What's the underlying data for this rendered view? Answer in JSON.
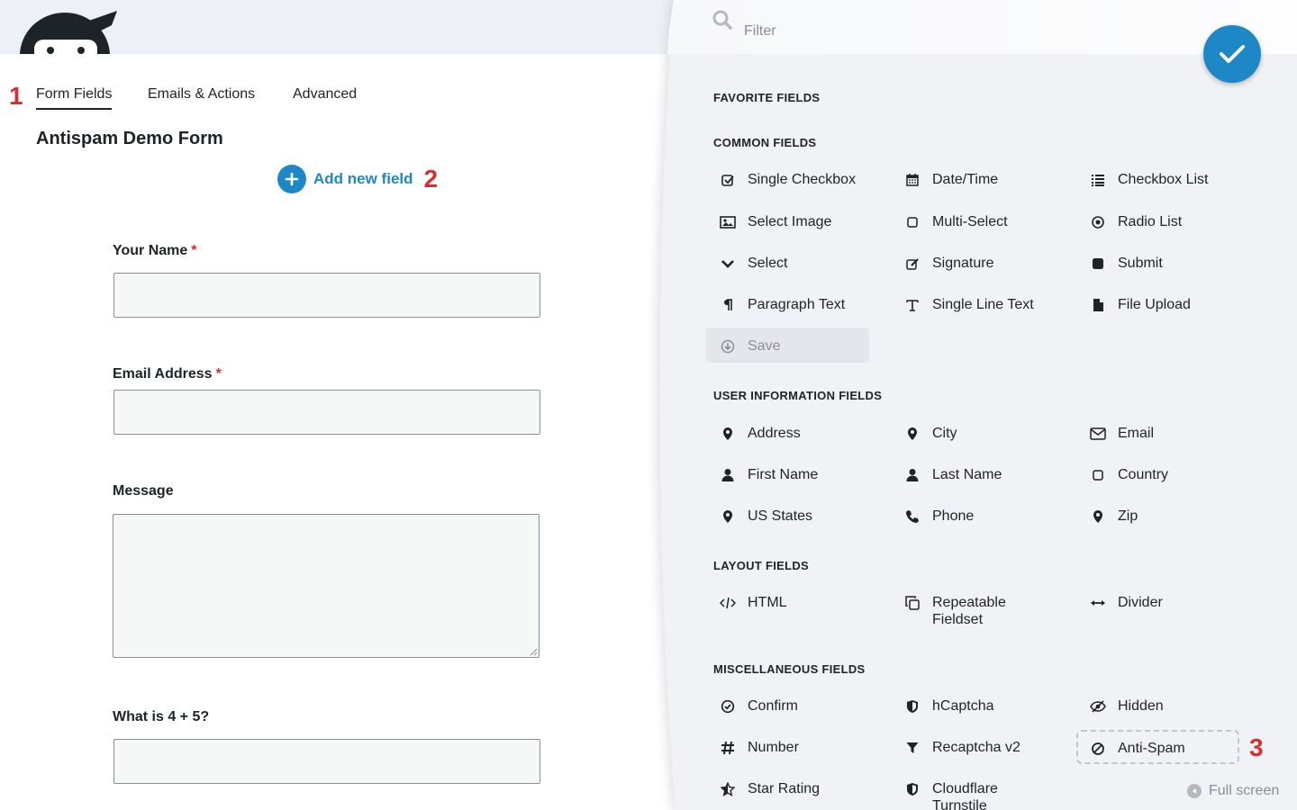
{
  "tabs": {
    "form_fields": "Form Fields",
    "emails_actions": "Emails & Actions",
    "advanced": "Advanced"
  },
  "annotations": {
    "one": "1",
    "two": "2",
    "three": "3"
  },
  "form": {
    "title": "Antispam Demo Form",
    "add_field_label": "Add new field",
    "fields": {
      "name_label": "Your Name",
      "email_label": "Email Address",
      "message_label": "Message",
      "math_label": "What is 4 + 5?",
      "required_mark": "*"
    }
  },
  "drawer": {
    "filter_placeholder": "Filter",
    "sections": {
      "favorite": "FAVORITE FIELDS",
      "common": "COMMON FIELDS",
      "user_info": "USER INFORMATION FIELDS",
      "layout": "LAYOUT FIELDS",
      "misc": "MISCELLANEOUS FIELDS"
    },
    "common": [
      "Single Checkbox",
      "Date/Time",
      "Checkbox List",
      "Select Image",
      "Multi-Select",
      "Radio List",
      "Select",
      "Signature",
      "Submit",
      "Paragraph Text",
      "Single Line Text",
      "File Upload",
      "Save"
    ],
    "user_info": [
      "Address",
      "City",
      "Email",
      "First Name",
      "Last Name",
      "Country",
      "US States",
      "Phone",
      "Zip"
    ],
    "layout": [
      "HTML",
      "Repeatable Fieldset",
      "Divider"
    ],
    "misc": [
      "Confirm",
      "hCaptcha",
      "Hidden",
      "Number",
      "Recaptcha v2",
      "Anti-Spam",
      "Star Rating",
      "Cloudflare Turnstile"
    ],
    "full_screen": "Full screen"
  },
  "colors": {
    "accent": "#1e88c7",
    "annotation": "#d32f2f",
    "required": "#d32f2f"
  }
}
